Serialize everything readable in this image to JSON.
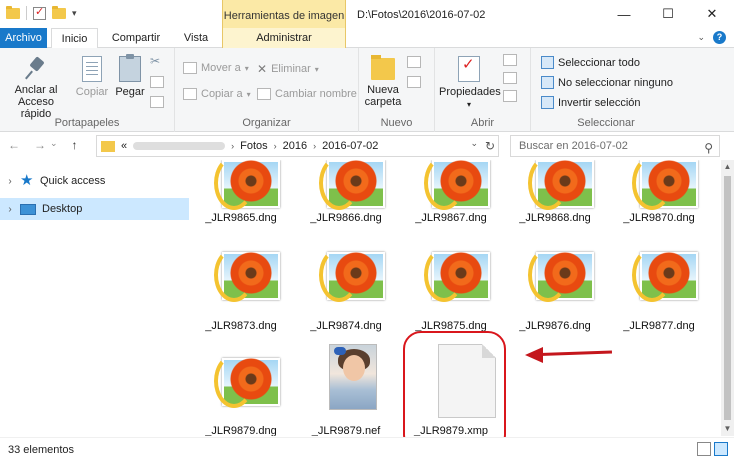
{
  "window": {
    "title": "D:\\Fotos\\2016\\2016-07-02",
    "context_tab_title": "Herramientas de imagen",
    "minimize": "—",
    "maximize": "☐",
    "close": "✕"
  },
  "quick_access_toolbar": {
    "dropdown": "▾"
  },
  "tabs": [
    {
      "label": "Archivo"
    },
    {
      "label": "Inicio"
    },
    {
      "label": "Compartir"
    },
    {
      "label": "Vista"
    },
    {
      "label": "Administrar"
    }
  ],
  "ribbon": {
    "portapapeles": {
      "label": "Portapapeles",
      "anclar": "Anclar al Acceso rápido",
      "copiar": "Copiar",
      "pegar": "Pegar"
    },
    "organizar": {
      "label": "Organizar",
      "mover_a": "Mover a",
      "copiar_a": "Copiar a",
      "eliminar": "Eliminar",
      "cambiar_nombre": "Cambiar nombre"
    },
    "nuevo": {
      "label": "Nuevo",
      "nueva_carpeta": "Nueva carpeta"
    },
    "abrir": {
      "label": "Abrir",
      "propiedades": "Propiedades"
    },
    "seleccionar": {
      "label": "Seleccionar",
      "seleccionar_todo": "Seleccionar todo",
      "no_seleccionar": "No seleccionar ninguno",
      "invertir": "Invertir selección"
    }
  },
  "address": {
    "overflow": "«",
    "crumbs": [
      "Fotos",
      "2016",
      "2016-07-02"
    ],
    "search_placeholder": "Buscar en 2016-07-02"
  },
  "nav_pane": [
    {
      "label": "Quick access"
    },
    {
      "label": "Desktop"
    }
  ],
  "files": [
    {
      "name": "_JLR9865.dng",
      "kind": "dng"
    },
    {
      "name": "_JLR9866.dng",
      "kind": "dng"
    },
    {
      "name": "_JLR9867.dng",
      "kind": "dng"
    },
    {
      "name": "_JLR9868.dng",
      "kind": "dng"
    },
    {
      "name": "_JLR9870.dng",
      "kind": "dng"
    },
    {
      "name": "_JLR9873.dng",
      "kind": "dng"
    },
    {
      "name": "_JLR9874.dng",
      "kind": "dng"
    },
    {
      "name": "_JLR9875.dng",
      "kind": "dng"
    },
    {
      "name": "_JLR9876.dng",
      "kind": "dng"
    },
    {
      "name": "_JLR9877.dng",
      "kind": "dng"
    },
    {
      "name": "_JLR9879.dng",
      "kind": "dng"
    },
    {
      "name": "_JLR9879.nef",
      "kind": "nef"
    },
    {
      "name": "_JLR9879.xmp",
      "kind": "xmp"
    }
  ],
  "status": {
    "count": "33 elementos"
  },
  "colors": {
    "accent": "#1979ca",
    "annotation": "#d9161c",
    "context_tab": "#fbe9a6"
  }
}
